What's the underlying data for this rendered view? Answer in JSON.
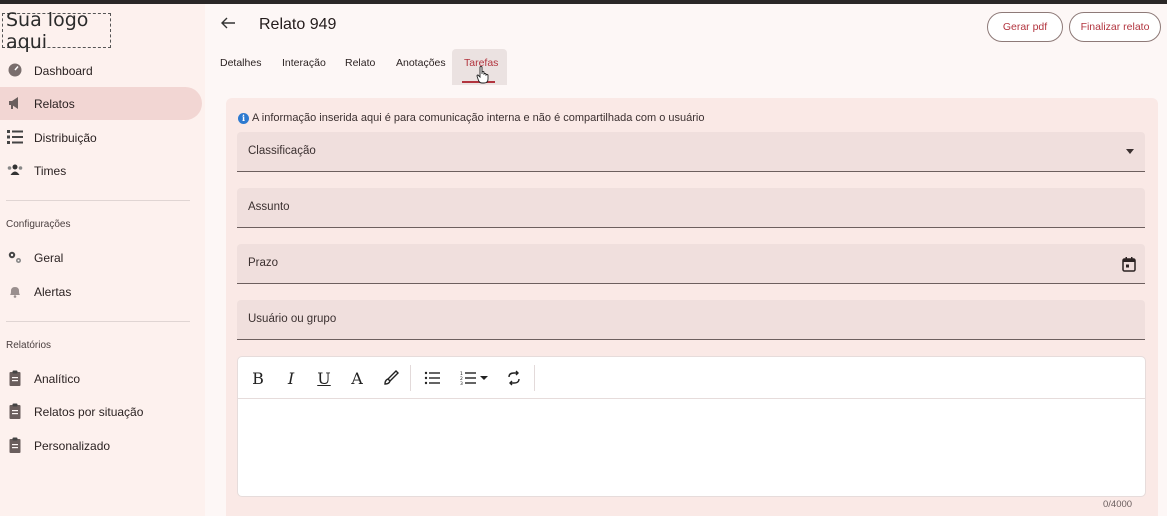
{
  "app": {
    "logo_text": "Sua logo aqui",
    "accent_color": "#b2343e"
  },
  "sidebar": {
    "main_items": [
      {
        "label": "Dashboard",
        "icon": "gauge-icon",
        "active": false
      },
      {
        "label": "Relatos",
        "icon": "megaphone-icon",
        "active": true
      },
      {
        "label": "Distribuição",
        "icon": "list-tree-icon",
        "active": false
      },
      {
        "label": "Times",
        "icon": "team-icon",
        "active": false
      }
    ],
    "config_section": "Configurações",
    "config_items": [
      {
        "label": "Geral",
        "icon": "gears-icon"
      },
      {
        "label": "Alertas",
        "icon": "bell-icon"
      }
    ],
    "reports_section": "Relatórios",
    "report_items": [
      {
        "label": "Analítico",
        "icon": "clipboard-icon"
      },
      {
        "label": "Relatos por situação",
        "icon": "clipboard-icon"
      },
      {
        "label": "Personalizado",
        "icon": "clipboard-icon"
      }
    ]
  },
  "header": {
    "title": "Relato 949",
    "generate_pdf": "Gerar pdf",
    "finalize": "Finalizar relato"
  },
  "tabs": [
    {
      "label": "Detalhes",
      "active": false
    },
    {
      "label": "Interação",
      "active": false
    },
    {
      "label": "Relato",
      "active": false
    },
    {
      "label": "Anotações",
      "active": false
    },
    {
      "label": "Tarefas",
      "active": true
    }
  ],
  "form": {
    "info_text": "A informação inserida aqui é para comunicação interna e não é compartilhada com o usuário",
    "classification_label": "Classificação",
    "subject_label": "Assunto",
    "deadline_label": "Prazo",
    "user_group_label": "Usuário ou grupo",
    "char_counter": "0/4000"
  },
  "editor_toolbar": {
    "bold": "B",
    "italic": "I",
    "underline": "U",
    "font_color": "A"
  }
}
